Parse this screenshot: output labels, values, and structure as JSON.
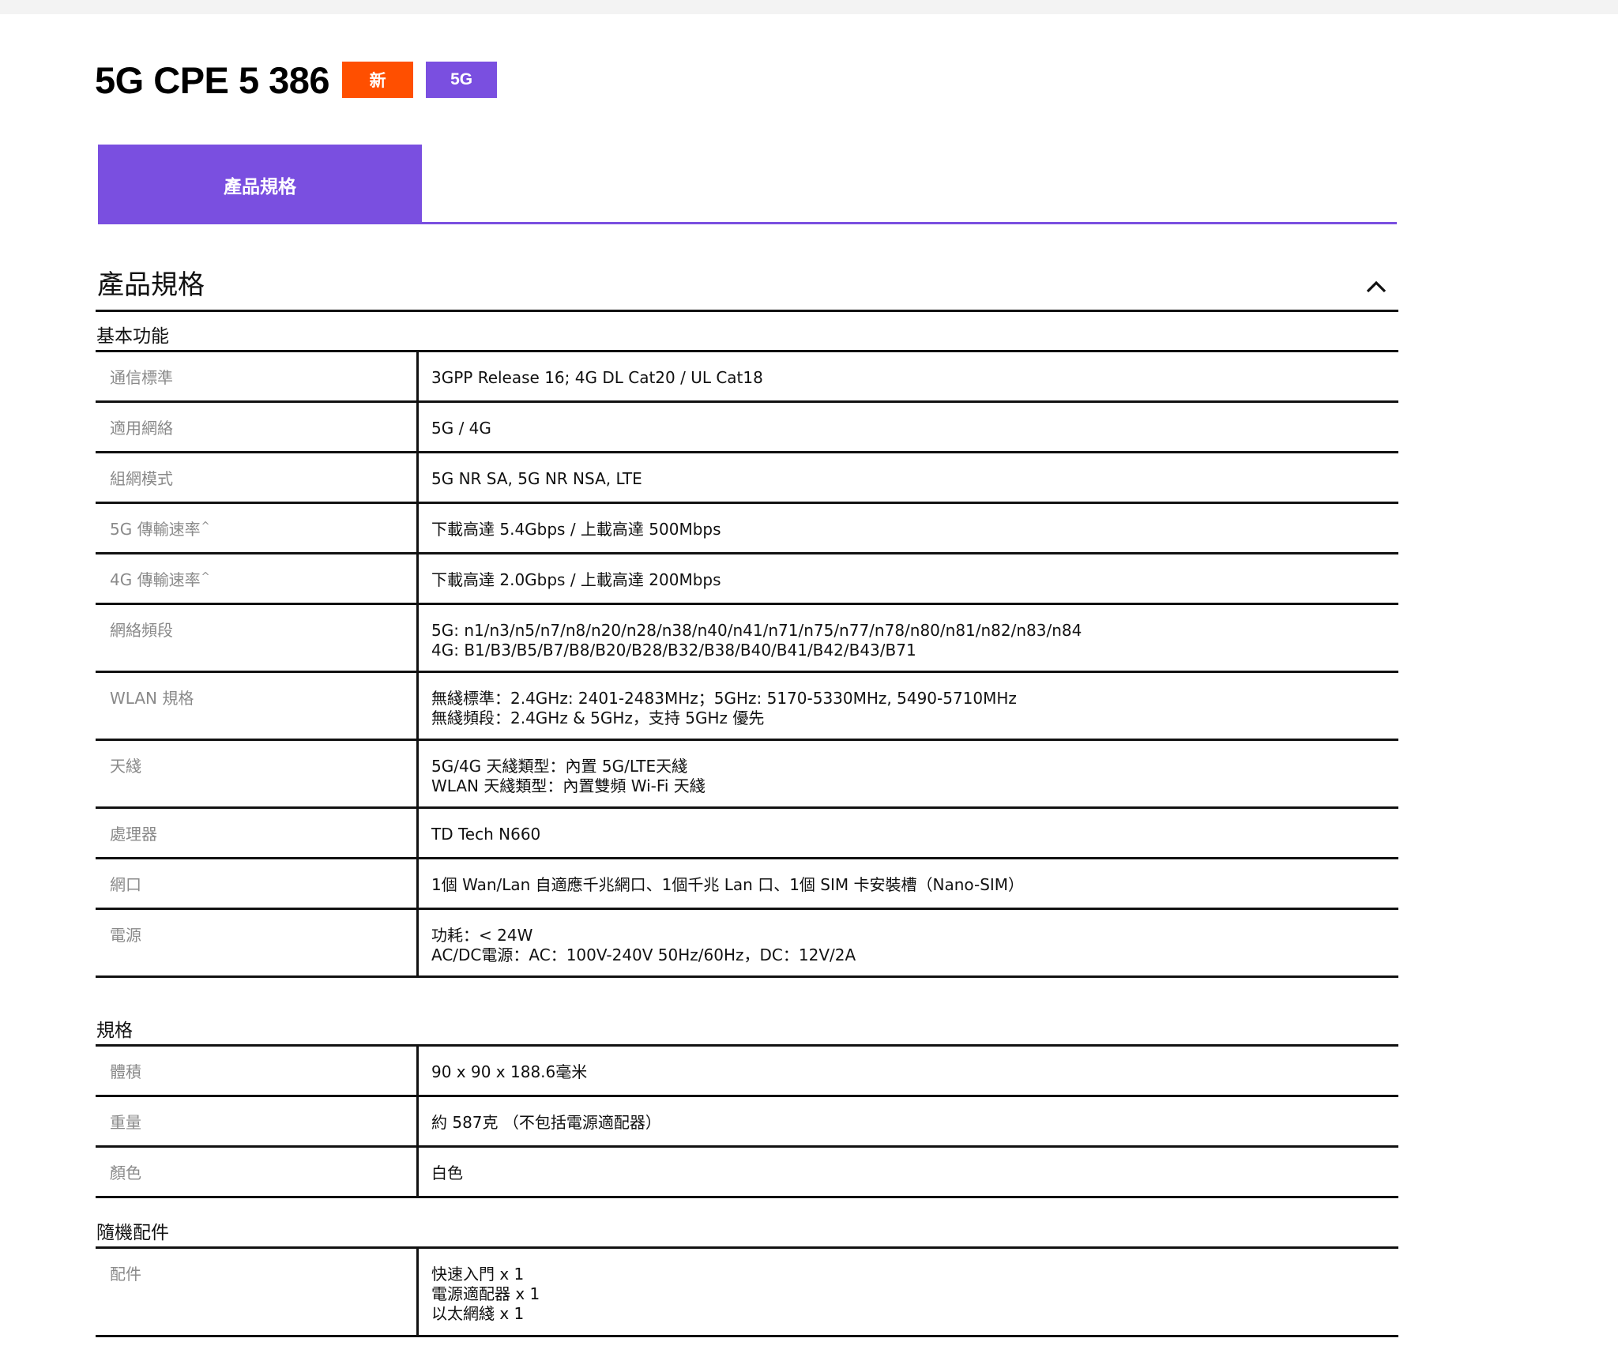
{
  "product": {
    "title": "5G CPE 5 386",
    "badges": [
      {
        "label": "新",
        "color": "#ff4f00"
      },
      {
        "label": "5G",
        "color": "#7a4fe0"
      }
    ]
  },
  "tabs": [
    {
      "label": "產品規格",
      "active": true
    }
  ],
  "section": {
    "title": "產品規格",
    "collapse_icon": "chevron-up-icon"
  },
  "groups": [
    {
      "title": "基本功能",
      "rows": [
        {
          "label": "通信標準",
          "values": [
            "3GPP Release 16; 4G DL Cat20 / UL Cat18"
          ]
        },
        {
          "label": "適用網絡",
          "values": [
            "5G / 4G"
          ]
        },
        {
          "label": "組網模式",
          "values": [
            "5G NR SA, 5G NR NSA, LTE"
          ]
        },
        {
          "label": "5G 傳輸速率",
          "sup": "^",
          "values": [
            "下載高達 5.4Gbps / 上載高達 500Mbps"
          ]
        },
        {
          "label": "4G 傳輸速率",
          "sup": "^",
          "values": [
            "下載高達 2.0Gbps / 上載高達 200Mbps"
          ]
        },
        {
          "label": "網絡頻段",
          "values": [
            "5G: n1/n3/n5/n7/n8/n20/n28/n38/n40/n41/n71/n75/n77/n78/n80/n81/n82/n83/n84",
            "4G: B1/B3/B5/B7/B8/B20/B28/B32/B38/B40/B41/B42/B43/B71"
          ]
        },
        {
          "label": "WLAN 規格",
          "values": [
            "無綫標準：2.4GHz: 2401-2483MHz；5GHz: 5170-5330MHz, 5490-5710MHz",
            "無綫頻段：2.4GHz & 5GHz，支持 5GHz 優先"
          ]
        },
        {
          "label": "天綫",
          "values": [
            "5G/4G 天綫類型：內置 5G/LTE天綫",
            "WLAN 天綫類型：內置雙頻 Wi-Fi 天綫"
          ]
        },
        {
          "label": "處理器",
          "values": [
            "TD Tech N660"
          ]
        },
        {
          "label": "網口",
          "values": [
            "1個 Wan/Lan 自適應千兆網口、1個千兆 Lan 口、1個 SIM 卡安裝槽（Nano-SIM）"
          ]
        },
        {
          "label": "電源",
          "values": [
            "功耗：< 24W",
            "AC/DC電源：AC：100V-240V 50Hz/60Hz，DC：12V/2A"
          ]
        }
      ]
    },
    {
      "title": "規格",
      "rows": [
        {
          "label": "體積",
          "values": [
            "90 x 90 x 188.6毫米"
          ]
        },
        {
          "label": "重量",
          "values": [
            "約 587克 （不包括電源適配器）"
          ]
        },
        {
          "label": "顏色",
          "values": [
            "白色"
          ]
        }
      ]
    },
    {
      "title": "隨機配件",
      "rows": [
        {
          "label": "配件",
          "values": [
            "快速入門 x 1",
            "電源適配器 x 1",
            "以太網綫 x 1"
          ]
        }
      ]
    }
  ]
}
